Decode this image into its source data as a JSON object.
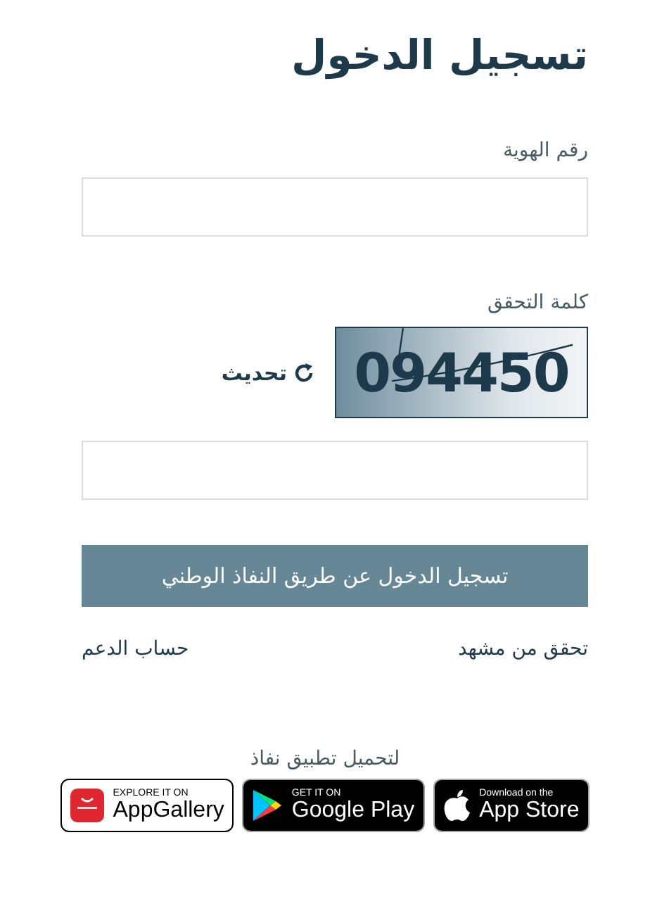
{
  "title": "تسجيل الدخول",
  "id_field": {
    "label": "رقم الهوية"
  },
  "captcha": {
    "label": "كلمة التحقق",
    "code": "094450",
    "refresh": "تحديث"
  },
  "submit": "تسجيل الدخول عن طريق النفاذ الوطني",
  "links": [
    {
      "text": "تحقق من مشهد"
    },
    {
      "text": "حساب الدعم"
    }
  ],
  "download": {
    "text": "لتحميل تطبيق نفاذ",
    "badges": [
      {
        "kind": "appstore",
        "small": "Download on the",
        "big": "App Store"
      },
      {
        "kind": "googleplay",
        "small": "GET IT ON",
        "big": "Google Play"
      },
      {
        "kind": "appgallery",
        "small": "EXPLORE IT ON",
        "big": "AppGallery"
      }
    ]
  }
}
